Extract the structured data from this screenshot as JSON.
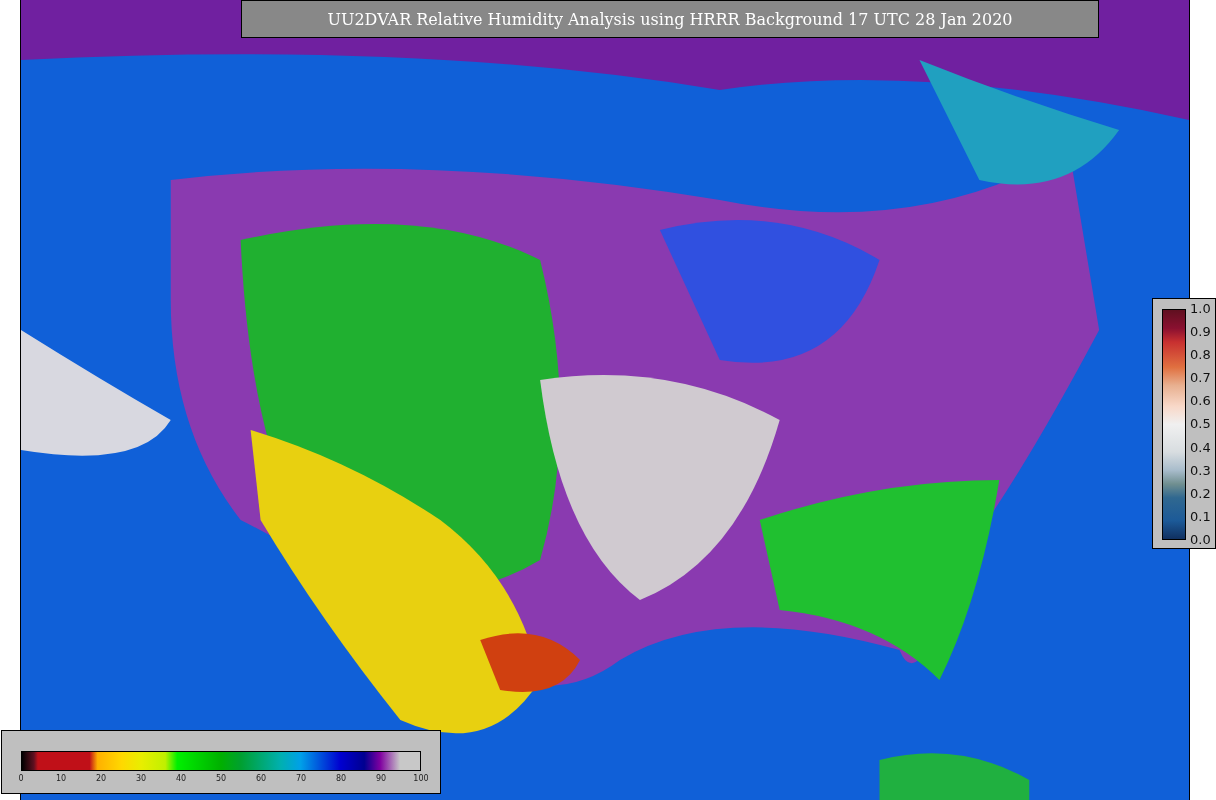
{
  "title": "UU2DVAR Relative Humidity Analysis using HRRR Background 17 UTC 28 Jan 2020",
  "humidity_colorbar": {
    "ticks": [
      "0",
      "10",
      "20",
      "30",
      "40",
      "50",
      "60",
      "70",
      "80",
      "90",
      "100"
    ]
  },
  "observation_colorbar": {
    "ticks": [
      "1.0",
      "0.9",
      "0.8",
      "0.7",
      "0.6",
      "0.5",
      "0.4",
      "0.3",
      "0.2",
      "0.1",
      "0.0"
    ]
  }
}
